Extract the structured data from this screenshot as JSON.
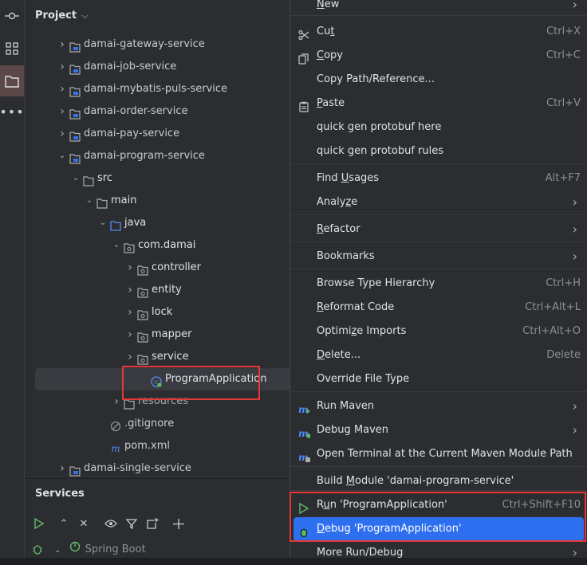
{
  "project": {
    "title": "Project",
    "tree": [
      {
        "label": "damai-gateway-service",
        "type": "module",
        "expanded": false
      },
      {
        "label": "damai-job-service",
        "type": "module",
        "expanded": false
      },
      {
        "label": "damai-mybatis-puls-service",
        "type": "module",
        "expanded": false
      },
      {
        "label": "damai-order-service",
        "type": "module",
        "expanded": false
      },
      {
        "label": "damai-pay-service",
        "type": "module",
        "expanded": false
      },
      {
        "label": "damai-program-service",
        "type": "module",
        "expanded": true
      },
      {
        "label": "src",
        "type": "folder",
        "expanded": true
      },
      {
        "label": "main",
        "type": "folder",
        "expanded": true
      },
      {
        "label": "java",
        "type": "source-folder",
        "expanded": true
      },
      {
        "label": "com.damai",
        "type": "package",
        "expanded": true
      },
      {
        "label": "controller",
        "type": "package",
        "expanded": false
      },
      {
        "label": "entity",
        "type": "package",
        "expanded": false
      },
      {
        "label": "lock",
        "type": "package",
        "expanded": false
      },
      {
        "label": "mapper",
        "type": "package",
        "expanded": false
      },
      {
        "label": "service",
        "type": "package",
        "expanded": false
      },
      {
        "label": "ProgramApplication",
        "type": "spring-class",
        "selected": true
      },
      {
        "label": "resources",
        "type": "folder",
        "expanded": false
      },
      {
        "label": ".gitignore",
        "type": "gitignore"
      },
      {
        "label": "pom.xml",
        "type": "maven"
      },
      {
        "label": "damai-single-service",
        "type": "module",
        "expanded": false
      }
    ]
  },
  "services": {
    "title": "Services",
    "tree_item": "Spring Boot"
  },
  "menu": {
    "items": [
      {
        "label": "New",
        "mnemonic_index": 0,
        "submenu": true
      },
      {
        "label": "Cut",
        "mnemonic_index": 2,
        "shortcut": "Ctrl+X",
        "icon": "scissors-icon"
      },
      {
        "label": "Copy",
        "mnemonic_index": 0,
        "shortcut": "Ctrl+C",
        "icon": "copy-icon"
      },
      {
        "label": "Copy Path/Reference...",
        "shortcut": ""
      },
      {
        "label": "Paste",
        "mnemonic_index": 0,
        "shortcut": "Ctrl+V",
        "icon": "clipboard-icon"
      },
      {
        "label": "quick gen protobuf here"
      },
      {
        "label": "quick gen protobuf rules"
      },
      {
        "label": "Find Usages",
        "mnemonic_index": 5,
        "shortcut": "Alt+F7"
      },
      {
        "label": "Analyze",
        "mnemonic_index": 5,
        "submenu": true
      },
      {
        "label": "Refactor",
        "mnemonic_index": 0,
        "submenu": true
      },
      {
        "label": "Bookmarks",
        "submenu": true
      },
      {
        "label": "Browse Type Hierarchy",
        "shortcut": "Ctrl+H"
      },
      {
        "label": "Reformat Code",
        "mnemonic_index": 0,
        "shortcut": "Ctrl+Alt+L"
      },
      {
        "label": "Optimize Imports",
        "mnemonic_index": 6,
        "shortcut": "Ctrl+Alt+O"
      },
      {
        "label": "Delete...",
        "mnemonic_index": 0,
        "shortcut": "Delete"
      },
      {
        "label": "Override File Type"
      },
      {
        "label": "Run Maven",
        "submenu": true,
        "icon": "maven-run-icon"
      },
      {
        "label": "Debug Maven",
        "submenu": true,
        "icon": "maven-debug-icon"
      },
      {
        "label": "Open Terminal at the Current Maven Module Path",
        "icon": "maven-terminal-icon"
      },
      {
        "label": "Build Module 'damai-program-service'",
        "mnemonic_index": 6
      },
      {
        "label": "Run 'ProgramApplication'",
        "mnemonic_index": 1,
        "shortcut": "Ctrl+Shift+F10",
        "icon": "run-icon"
      },
      {
        "label": "Debug 'ProgramApplication'",
        "mnemonic_index": 0,
        "icon": "debug-icon",
        "highlighted": true
      },
      {
        "label": "More Run/Debug",
        "submenu": true
      }
    ]
  },
  "colors": {
    "accent": "#2e6ff0",
    "annotation": "#e53935",
    "background": "#2b2d30"
  }
}
